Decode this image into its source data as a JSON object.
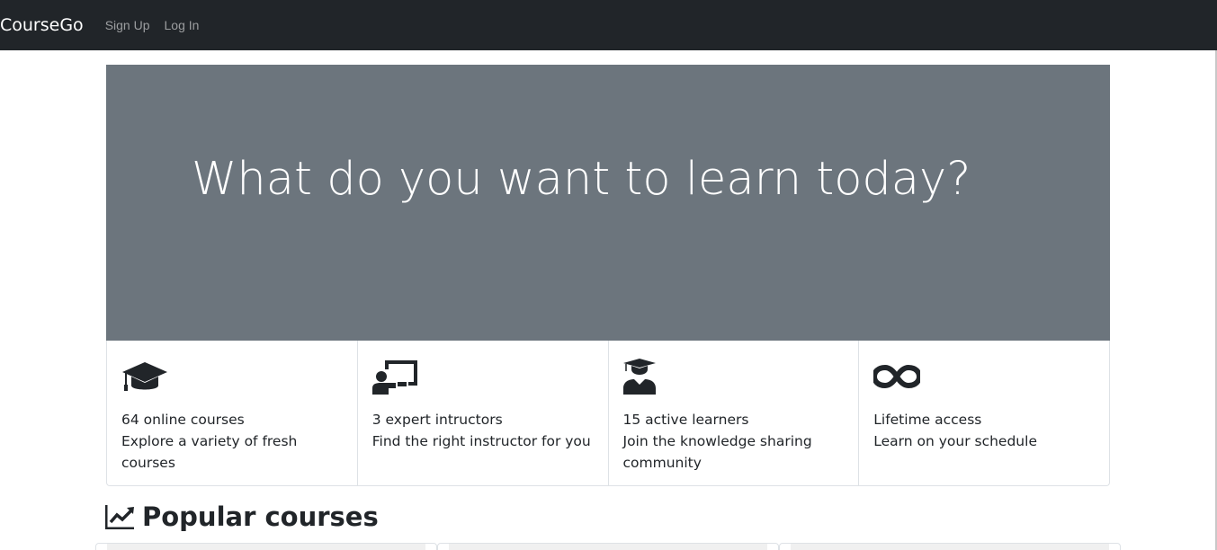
{
  "navbar": {
    "brand": "CourseGo",
    "links": [
      {
        "label": "Sign Up"
      },
      {
        "label": "Log In"
      }
    ]
  },
  "hero": {
    "title": "What do you want to learn today?"
  },
  "features": [
    {
      "icon": "graduation-cap-icon",
      "title": "64 online courses",
      "description": "Explore a variety of fresh courses"
    },
    {
      "icon": "chalkboard-teacher-icon",
      "title": "3 expert intructors",
      "description": "Find the right instructor for you"
    },
    {
      "icon": "user-graduate-icon",
      "title": "15 active learners",
      "description": "Join the knowledge sharing community"
    },
    {
      "icon": "infinity-icon",
      "title": "Lifetime access",
      "description": "Learn on your schedule"
    }
  ],
  "popular": {
    "title": "Popular courses",
    "icon": "chart-line-icon"
  },
  "colors": {
    "navbar": "#212529",
    "hero": "#6c757d",
    "text": "#212529"
  }
}
